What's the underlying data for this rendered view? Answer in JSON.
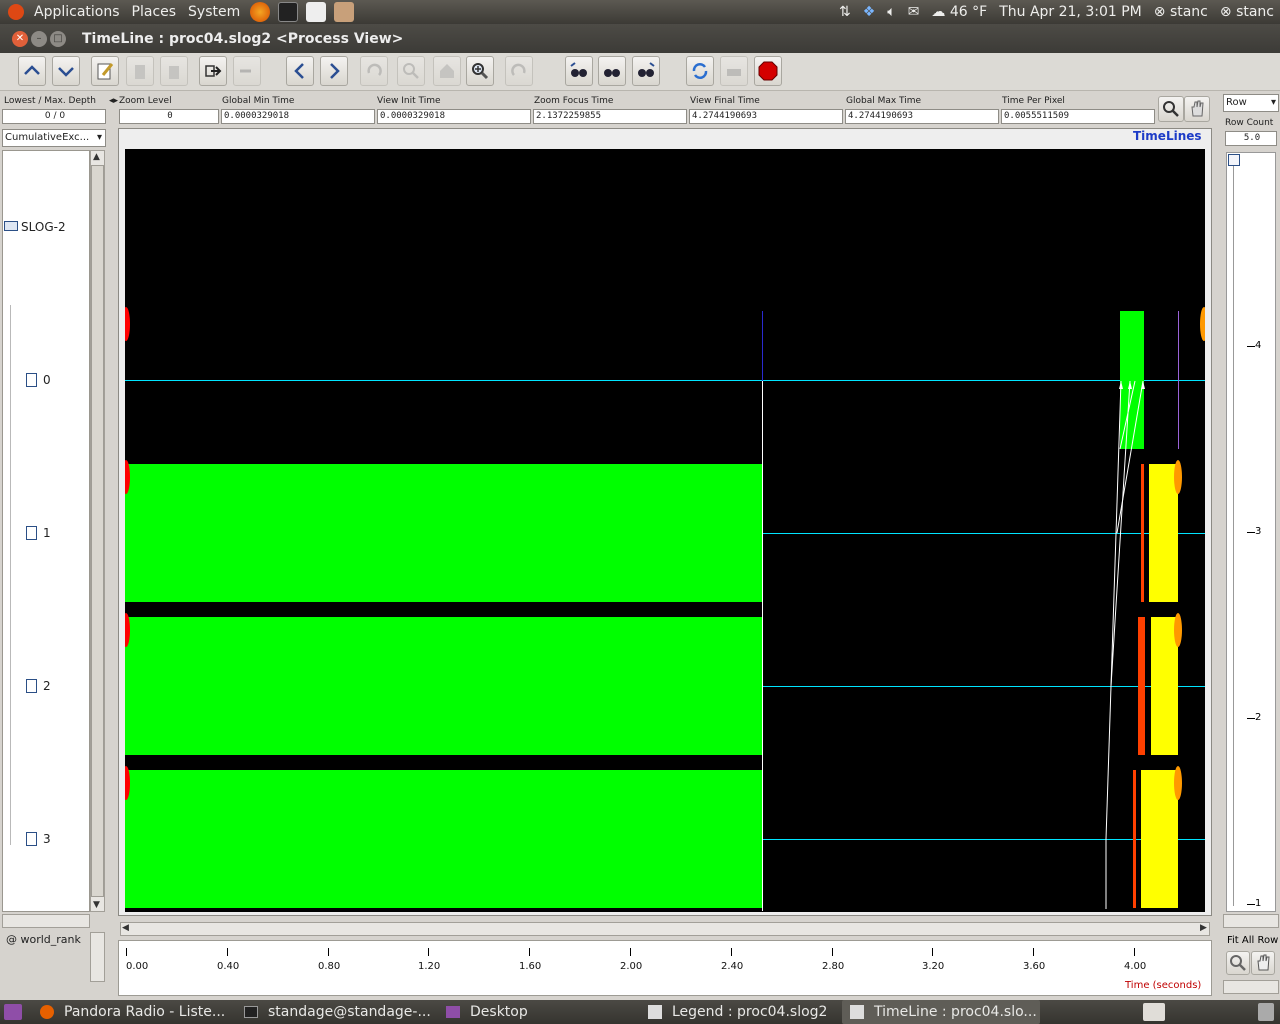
{
  "top_panel": {
    "menus": [
      "Applications",
      "Places",
      "System"
    ],
    "weather": "46 °F",
    "datetime": "Thu Apr 21,  3:01 PM",
    "user1": "stanc",
    "user2": "stanc"
  },
  "window": {
    "title": "TimeLine : proc04.slog2  <Process View>"
  },
  "header": {
    "depth_label": "Lowest / Max. Depth",
    "depth_value": "0 / 0",
    "zoom_label": "Zoom Level",
    "zoom_value": "0",
    "gmin_label": "Global Min Time",
    "gmin_value": "0.0000329018",
    "vinit_label": "View  Init Time",
    "vinit_value": "0.0000329018",
    "zfocus_label": "Zoom Focus Time",
    "zfocus_value": "2.1372259855",
    "vfinal_label": "View Final Time",
    "vfinal_value": "4.2744190693",
    "gmax_label": "Global Max Time",
    "gmax_value": "4.2744190693",
    "tpp_label": "Time Per Pixel",
    "tpp_value": "0.0055511509",
    "row_select": "Row",
    "row_count_label": "Row Count",
    "row_count_value": "5.0",
    "cumulative": "CumulativeExc..."
  },
  "tree": {
    "root": "SLOG-2",
    "ranks": [
      "0",
      "1",
      "2",
      "3"
    ],
    "bottom_label": "@ world_rank"
  },
  "canvas": {
    "title": "TimeLines",
    "axis_unit": "Time (seconds)",
    "ticks": [
      "0.00",
      "0.40",
      "0.80",
      "1.20",
      "1.60",
      "2.00",
      "2.40",
      "2.80",
      "3.20",
      "3.60",
      "4.00"
    ]
  },
  "right_ruler": {
    "labels": [
      "4",
      "3",
      "2",
      "1"
    ],
    "fit_label": "Fit All Row"
  },
  "taskbar": {
    "items": [
      "Pandora Radio - Liste...",
      "standage@standage-...",
      "Desktop",
      "Legend : proc04.slog2",
      "TimeLine : proc04.slo..."
    ]
  },
  "colors": {
    "green": "#00ff00",
    "yellow": "#ffff00",
    "orange": "#ff4000",
    "cyan": "#00ffff",
    "red": "#ff0000"
  }
}
